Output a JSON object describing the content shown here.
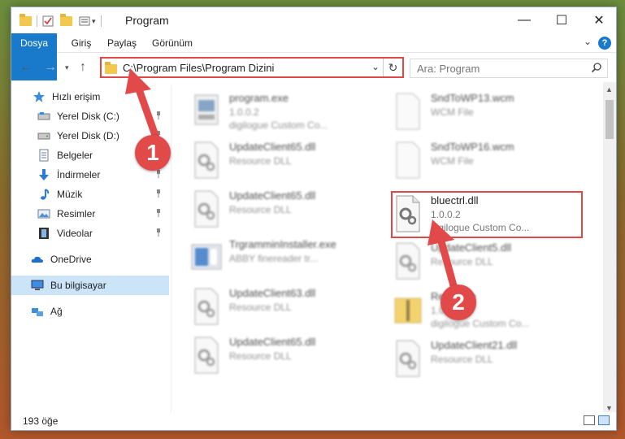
{
  "window": {
    "title": "Program",
    "controls": {
      "minimize": "—",
      "maximize": "☐",
      "close": "✕"
    }
  },
  "ribbon": {
    "tabs": [
      "Dosya",
      "Giriş",
      "Paylaş",
      "Görünüm"
    ],
    "help": "?"
  },
  "address": {
    "path": "C:\\Program Files\\Program Dizini",
    "search_placeholder": "Ara: Program"
  },
  "sidebar": {
    "items": [
      {
        "label": "Hızlı erişim",
        "icon": "star-icon",
        "pinned": false
      },
      {
        "label": "Yerel Disk (C:)",
        "icon": "drive-icon",
        "pinned": true
      },
      {
        "label": "Yerel Disk (D:)",
        "icon": "drive-icon",
        "pinned": true
      },
      {
        "label": "Belgeler",
        "icon": "document-icon",
        "pinned": true
      },
      {
        "label": "İndirmeler",
        "icon": "download-icon",
        "pinned": true
      },
      {
        "label": "Müzik",
        "icon": "music-icon",
        "pinned": true
      },
      {
        "label": "Resimler",
        "icon": "pictures-icon",
        "pinned": true
      },
      {
        "label": "Videolar",
        "icon": "film-icon",
        "pinned": true
      },
      {
        "label": "OneDrive",
        "icon": "cloud-icon",
        "pinned": false
      },
      {
        "label": "Bu bilgisayar",
        "icon": "computer-icon",
        "pinned": false,
        "selected": true
      },
      {
        "label": "Ağ",
        "icon": "network-icon",
        "pinned": false
      }
    ]
  },
  "files": [
    {
      "name": "program.exe",
      "line1": "1.0.0.2",
      "line2": "digilogue Custom Co...",
      "icon": "exe-icon",
      "blurred": true
    },
    {
      "name": "SndToWP13.wcm",
      "line1": "WCM File",
      "line2": "",
      "icon": "blank-file-icon",
      "blurred": true
    },
    {
      "name": "UpdateClient65.dll",
      "line1": "Resource DLL",
      "line2": "",
      "icon": "dll-icon",
      "blurred": true
    },
    {
      "name": "SndToWP16.wcm",
      "line1": "WCM File",
      "line2": "",
      "icon": "blank-file-icon",
      "blurred": true
    },
    {
      "name": "UpdateClient65.dll",
      "line1": "Resource DLL",
      "line2": "",
      "icon": "dll-icon",
      "blurred": true
    },
    {
      "name": "bluectrl.dll",
      "line1": "1.0.0.2",
      "line2": "digilogue Custom Co...",
      "icon": "dll-icon",
      "blurred": false
    },
    {
      "name": "TrgramminInstaller.exe",
      "line1": "ABBY finereader tr...",
      "line2": "",
      "icon": "installer-icon",
      "blurred": true
    },
    {
      "name": "UpdateClient5.dll",
      "line1": "Resource DLL",
      "line2": "",
      "icon": "dll-icon",
      "blurred": true
    },
    {
      "name": "UpdateClient63.dll",
      "line1": "Resource DLL",
      "line2": "",
      "icon": "dll-icon",
      "blurred": true
    },
    {
      "name": "Resource",
      "line1": "1.0.0.2",
      "line2": "digilogue Custom Co...",
      "icon": "zip-folder-icon",
      "blurred": true
    },
    {
      "name": "UpdateClient65.dll",
      "line1": "Resource DLL",
      "line2": "",
      "icon": "dll-icon",
      "blurred": true
    },
    {
      "name": "UpdateClient21.dll",
      "line1": "Resource DLL",
      "line2": "",
      "icon": "dll-icon",
      "blurred": true
    }
  ],
  "status": {
    "count": "193 öğe"
  },
  "callouts": [
    "1",
    "2"
  ],
  "colors": {
    "accent": "#1979ca",
    "highlight": "#e04848",
    "badge": "#e24a4a",
    "selected": "#cce4f7"
  }
}
